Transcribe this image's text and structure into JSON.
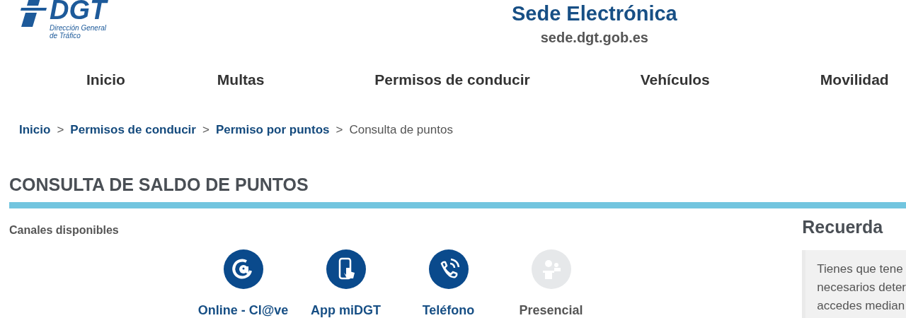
{
  "header": {
    "logo_text": "DGT",
    "logo_subtitle": [
      "Dirección General",
      "de Tráfico"
    ],
    "title": "Sede Electrónica",
    "subtitle": "sede.dgt.gob.es"
  },
  "nav": [
    {
      "label": "Inicio"
    },
    {
      "label": "Multas"
    },
    {
      "label": "Permisos de conducir"
    },
    {
      "label": "Vehículos"
    },
    {
      "label": "Movilidad"
    }
  ],
  "breadcrumb_separator": ">",
  "breadcrumb": [
    {
      "label": "Inicio",
      "link": true
    },
    {
      "label": "Permisos de conducir",
      "link": true
    },
    {
      "label": "Permiso por puntos",
      "link": true
    },
    {
      "label": "Consulta de puntos",
      "link": false
    }
  ],
  "page_title": "CONSULTA DE SALDO DE PUNTOS",
  "channels_label": "Canales disponibles",
  "channels": [
    {
      "kind": "online",
      "label": "Online - Cl@ve",
      "disabled": false
    },
    {
      "kind": "app",
      "label": "App miDGT",
      "disabled": false
    },
    {
      "kind": "phone",
      "label": "Teléfono",
      "disabled": false
    },
    {
      "kind": "inperson",
      "label": "Presencial",
      "disabled": true
    }
  ],
  "sidebar": {
    "title": "Recuerda",
    "lines": [
      "Tienes que tene",
      "necesarios deter",
      "accedes median"
    ]
  }
}
